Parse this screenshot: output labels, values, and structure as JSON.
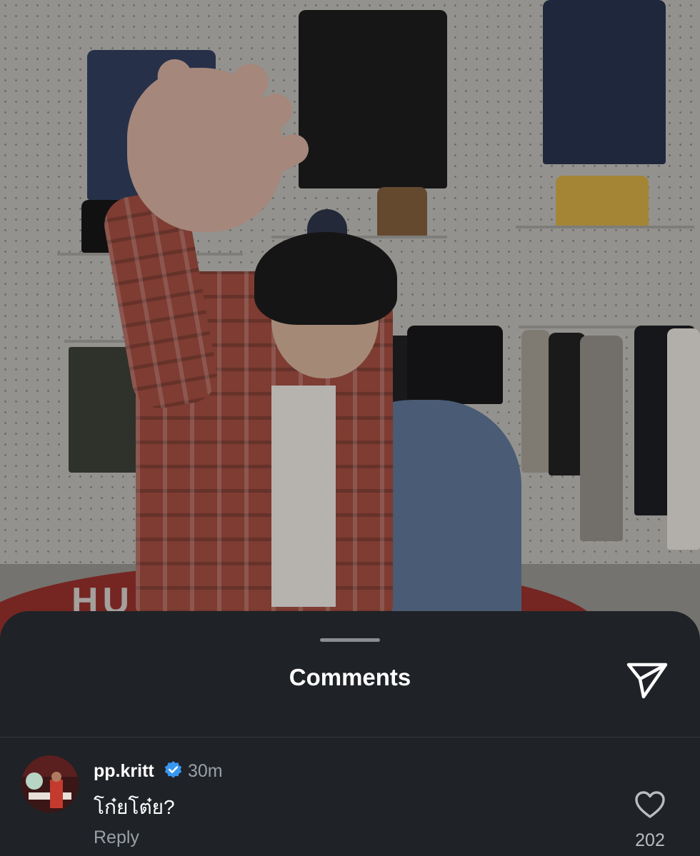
{
  "photo": {
    "rug_text": "HU"
  },
  "sheet": {
    "title": "Comments"
  },
  "comment": {
    "username": "pp.kritt",
    "verified": true,
    "time_ago": "30m",
    "text": "โก๋ยโต๋ย?",
    "reply_label": "Reply",
    "like_count": "202"
  },
  "icons": {
    "send": "send-icon",
    "like": "heart-icon",
    "verified": "verified-badge-icon"
  },
  "colors": {
    "sheet_bg": "#1f2226",
    "verified_blue": "#3897f0",
    "muted_text": "#9aa0a6"
  }
}
